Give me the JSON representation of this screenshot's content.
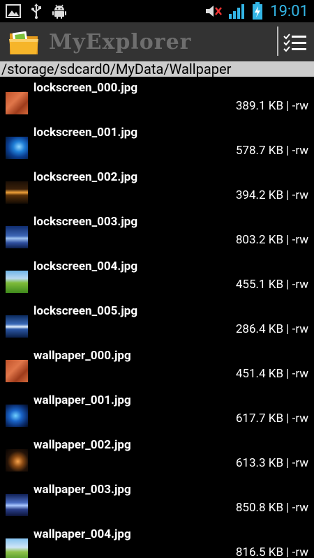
{
  "statusbar": {
    "time": "19:01",
    "icons_left": [
      "image-icon",
      "usb-icon",
      "android-icon"
    ],
    "icons_right": [
      "mute-icon",
      "signal-icon",
      "battery-charging-icon"
    ],
    "accent": "#33b5e5"
  },
  "app": {
    "title": "MyExplorer",
    "menu_icon": "sort-list-icon"
  },
  "path": "/storage/sdcard0/MyData/Wallpaper",
  "files": [
    {
      "name": "lockscreen_000.jpg",
      "meta": "389.1 KB | -rw",
      "thumb": "t-orange"
    },
    {
      "name": "lockscreen_001.jpg",
      "meta": "578.7 KB | -rw",
      "thumb": "t-blue-swirl"
    },
    {
      "name": "lockscreen_002.jpg",
      "meta": "394.2 KB | -rw",
      "thumb": "t-amber"
    },
    {
      "name": "lockscreen_003.jpg",
      "meta": "803.2 KB | -rw",
      "thumb": "t-sky"
    },
    {
      "name": "lockscreen_004.jpg",
      "meta": "455.1 KB | -rw",
      "thumb": "t-green"
    },
    {
      "name": "lockscreen_005.jpg",
      "meta": "286.4 KB | -rw",
      "thumb": "t-horizon"
    },
    {
      "name": "wallpaper_000.jpg",
      "meta": "451.4 KB | -rw",
      "thumb": "t-orange"
    },
    {
      "name": "wallpaper_001.jpg",
      "meta": "617.7 KB | -rw",
      "thumb": "t-blue-dark"
    },
    {
      "name": "wallpaper_002.jpg",
      "meta": "613.3 KB | -rw",
      "thumb": "t-ember"
    },
    {
      "name": "wallpaper_003.jpg",
      "meta": "850.8 KB | -rw",
      "thumb": "t-storm"
    },
    {
      "name": "wallpaper_004.jpg",
      "meta": "816.5 KB | -rw",
      "thumb": "t-meadow"
    }
  ]
}
